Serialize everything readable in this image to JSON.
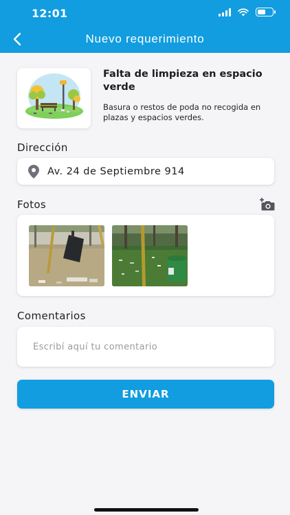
{
  "status_bar": {
    "time": "12:01",
    "battery_level": 0.55
  },
  "header": {
    "title": "Nuevo requerimiento",
    "back_icon": "chevron-left-icon",
    "background": "#119ddf"
  },
  "category": {
    "title": "Falta de limpieza en espacio verde",
    "description": "Basura o restos de poda no recogida en plazas y espacios verdes.",
    "icon": "park-illustration"
  },
  "address": {
    "label": "Dirección",
    "value": "Av. 24 de Septiembre 914",
    "icon": "location-pin-icon"
  },
  "photos": {
    "label": "Fotos",
    "add_icon": "add-photo-camera-icon",
    "items": [
      "photo-1",
      "photo-2"
    ]
  },
  "comments": {
    "label": "Comentarios",
    "placeholder": "Escribí aquí tu comentario",
    "value": ""
  },
  "submit": {
    "label": "ENVIAR",
    "color": "#119ddf"
  }
}
